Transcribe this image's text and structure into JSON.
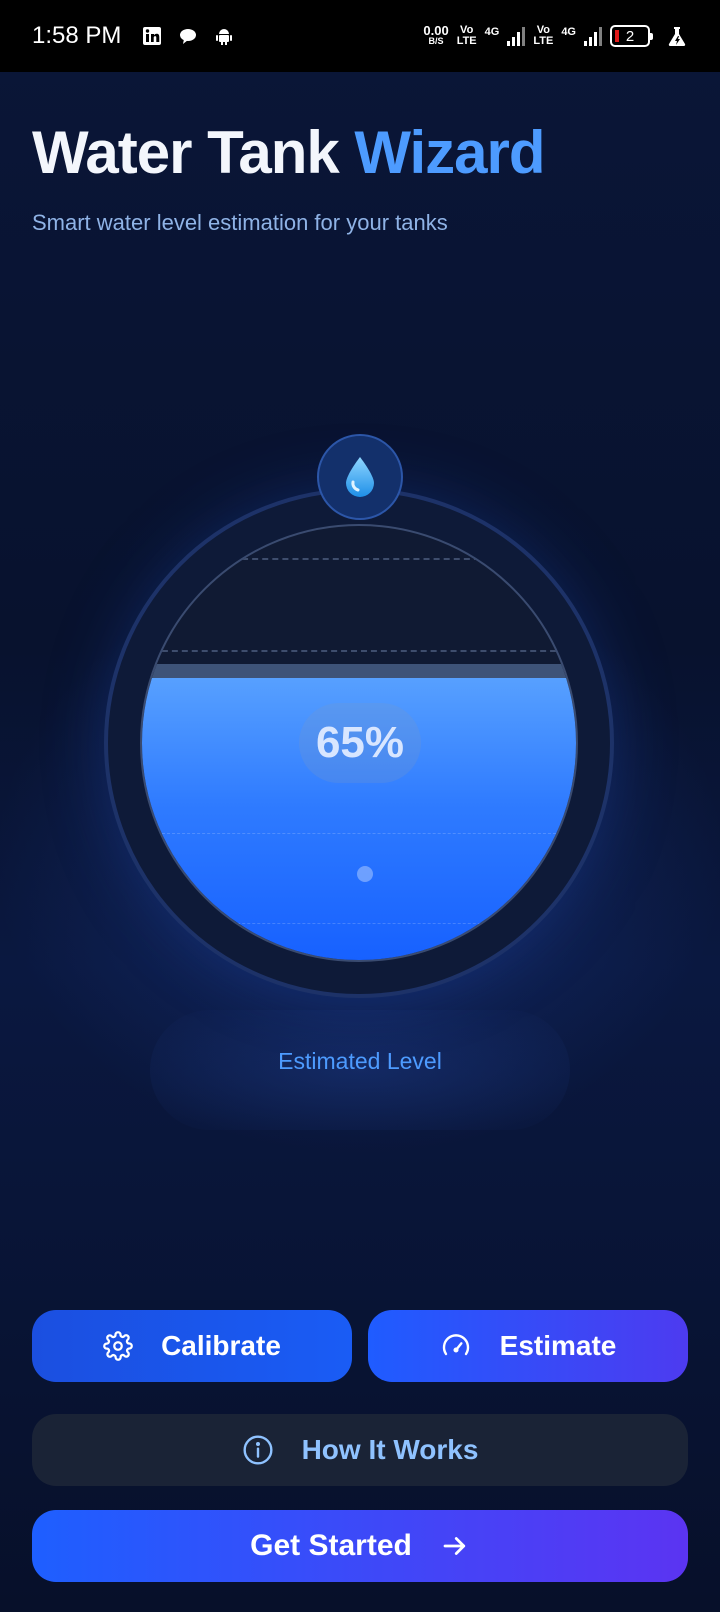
{
  "status_bar": {
    "time": "1:58 PM",
    "net_speed_value": "0.00",
    "net_speed_unit": "B/S",
    "sim1_label_top": "Vo",
    "sim1_label_bottom": "LTE",
    "sim1_network": "4G",
    "sim2_label_top": "Vo",
    "sim2_label_bottom": "LTE",
    "sim2_network": "4G",
    "battery_level": "2",
    "notification_icons": [
      "linkedin-icon",
      "chat-bubble-icon",
      "android-icon"
    ]
  },
  "header": {
    "title_part1": "Water Tank",
    "title_part2": "Wizard",
    "subtitle": "Smart water level estimation for your tanks"
  },
  "gauge": {
    "level_percent": 65,
    "level_text": "65%",
    "label": "Estimated Level",
    "icon": "water-drop-icon"
  },
  "actions": {
    "calibrate_label": "Calibrate",
    "estimate_label": "Estimate",
    "how_it_works_label": "How It Works",
    "get_started_label": "Get Started"
  },
  "colors": {
    "accent": "#4d9bff",
    "background": "#07102a",
    "water": "#2f7bff",
    "gradient_end": "#5b34f2"
  }
}
